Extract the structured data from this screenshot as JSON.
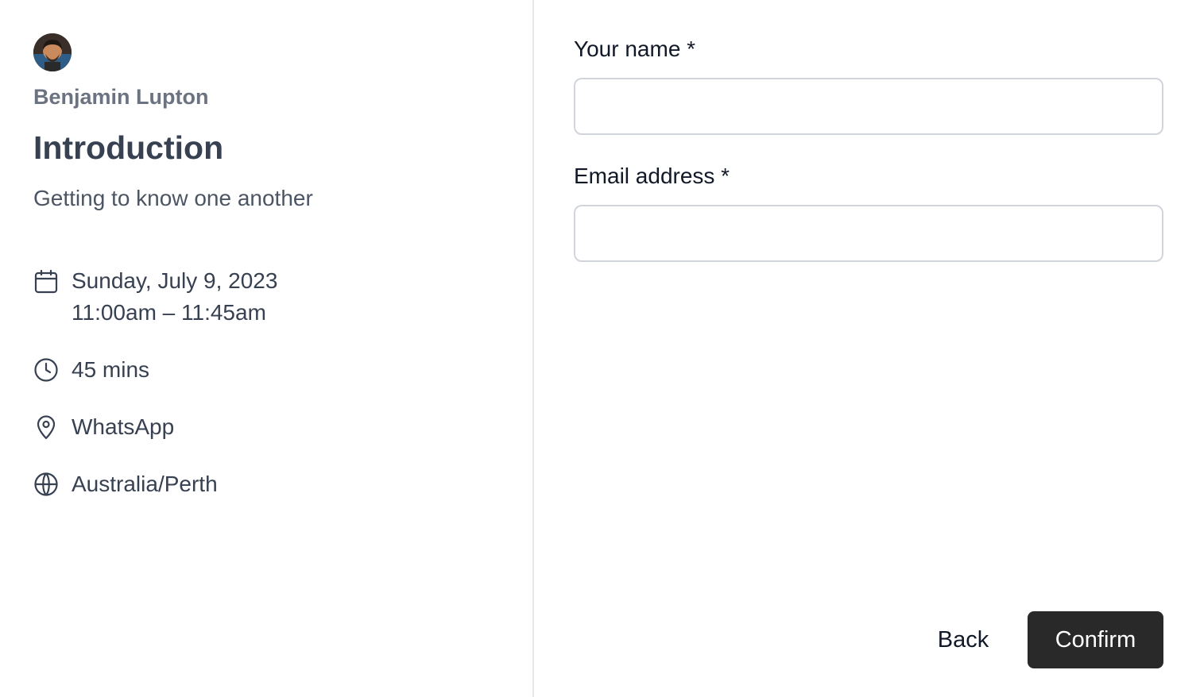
{
  "host": {
    "name": "Benjamin Lupton",
    "avatar_icon": "avatar-photo"
  },
  "event": {
    "title": "Introduction",
    "description": "Getting to know one another",
    "date": "Sunday, July 9, 2023",
    "time_range": "11:00am – 11:45am",
    "duration": "45 mins",
    "location": "WhatsApp",
    "timezone": "Australia/Perth"
  },
  "icons": {
    "date": "calendar-icon",
    "duration": "clock-icon",
    "location": "map-pin-icon",
    "timezone": "globe-icon"
  },
  "form": {
    "name_label": "Your name *",
    "name_value": "",
    "email_label": "Email address *",
    "email_value": ""
  },
  "actions": {
    "back_label": "Back",
    "confirm_label": "Confirm"
  },
  "colors": {
    "confirm_bg": "#292929",
    "divider": "#e5e7eb",
    "input_border": "#d1d5db"
  }
}
